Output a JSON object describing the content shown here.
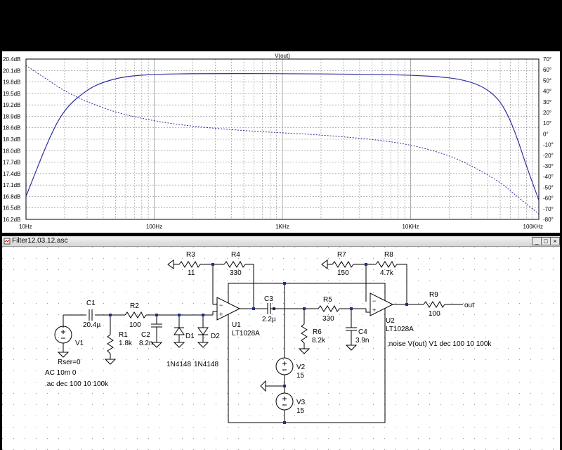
{
  "plot": {
    "trace_label": "V(out)",
    "y_left_ticks": [
      "20.4dB",
      "20.1dB",
      "19.8dB",
      "19.5dB",
      "19.2dB",
      "18.9dB",
      "18.6dB",
      "18.3dB",
      "18.0dB",
      "17.7dB",
      "17.4dB",
      "17.1dB",
      "16.8dB",
      "16.5dB",
      "16.2dB"
    ],
    "y_right_ticks": [
      "70°",
      "60°",
      "50°",
      "40°",
      "30°",
      "20°",
      "10°",
      "0°",
      "-10°",
      "-20°",
      "-30°",
      "-40°",
      "-50°",
      "-60°",
      "-70°",
      "-80°"
    ],
    "x_ticks": [
      "10Hz",
      "100Hz",
      "1KHz",
      "10KHz",
      "100KHz"
    ],
    "trace_color": "#3030a0"
  },
  "chart_data": {
    "type": "line",
    "title": "V(out)",
    "x_scale": "log",
    "x_range_hz": [
      10,
      100000
    ],
    "y_left_range_db": [
      16.2,
      20.4
    ],
    "y_right_range_deg": [
      -80,
      70
    ],
    "series": [
      {
        "name": "V(out)",
        "units": "dB",
        "x": [
          10,
          15,
          20,
          30,
          40,
          60,
          100,
          200,
          1000,
          5000,
          10000,
          20000,
          30000,
          40000,
          50000,
          60000,
          70000,
          80000,
          100000
        ],
        "y": [
          16.8,
          18.3,
          19.1,
          19.6,
          19.8,
          19.95,
          20.0,
          20.02,
          20.02,
          20.0,
          19.98,
          19.92,
          19.8,
          19.6,
          19.3,
          18.8,
          18.2,
          17.6,
          16.7
        ]
      },
      {
        "name": "V(out)",
        "units": "deg",
        "style": "dashed",
        "x": [
          10,
          15,
          20,
          30,
          50,
          100,
          200,
          500,
          1000,
          2000,
          5000,
          10000,
          20000,
          30000,
          50000,
          70000,
          100000
        ],
        "y": [
          64,
          50,
          40,
          30,
          20,
          12,
          7,
          3,
          1,
          -1,
          -5,
          -10,
          -20,
          -30,
          -45,
          -60,
          -75
        ]
      }
    ]
  },
  "window": {
    "title": "Filter12.03.12.asc",
    "buttons": [
      "_",
      "□",
      "×"
    ]
  },
  "schematic": {
    "labels": {
      "c1": "C1",
      "c1v": "20.4µ",
      "r2": "R2",
      "r2v": "100",
      "r1": "R1",
      "r1v": "1.8k",
      "c2": "C2",
      "c2v": "8.2n",
      "d1": "D1",
      "d2": "D2",
      "d1v": "1N4148",
      "d2v": "1N4148",
      "v1": "V1",
      "rser": "Rser=0",
      "v1ac": "AC 10m 0",
      "ac_cmd": ".ac dec 100 10 100k",
      "r3": "R3",
      "r3v": "11",
      "r4": "R4",
      "r4v": "330",
      "u1": "U1",
      "u1v": "LT1028A",
      "c3": "C3",
      "c3v": "2.2µ",
      "r5": "R5",
      "r5v": "330",
      "r6": "R6",
      "r6v": "8.2k",
      "c4": "C4",
      "c4v": "3.9n",
      "v2": "V2",
      "v2v": "15",
      "v3": "V3",
      "v3v": "15",
      "r7": "R7",
      "r7v": "150",
      "r8": "R8",
      "r8v": "4.7k",
      "u2": "U2",
      "u2v": "LT1028A",
      "r9": "R9",
      "r9v": "100",
      "out": "out",
      "noise_cmd": ";noise V(out) V1 dec 100 10 100k"
    }
  }
}
